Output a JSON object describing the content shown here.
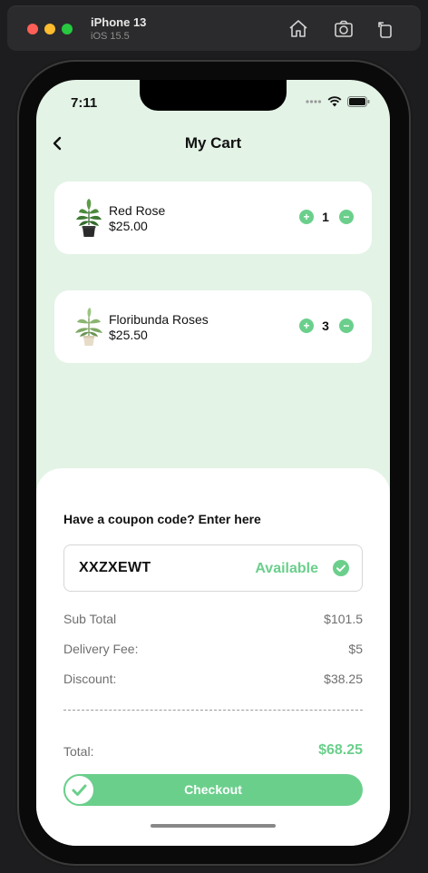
{
  "simulator": {
    "device_name": "iPhone 13",
    "os_version": "iOS 15.5"
  },
  "status_bar": {
    "time": "7:11"
  },
  "header": {
    "title": "My Cart"
  },
  "cart": {
    "items": [
      {
        "name": "Red Rose",
        "price": "$25.00",
        "quantity": "1"
      },
      {
        "name": "Floribunda Roses",
        "price": "$25.50",
        "quantity": "3"
      }
    ]
  },
  "coupon": {
    "heading": "Have a coupon code? Enter here",
    "code": "XXZXEWT",
    "status": "Available"
  },
  "summary": {
    "subtotal_label": "Sub Total",
    "subtotal_value": "$101.5",
    "delivery_label": "Delivery Fee:",
    "delivery_value": "$5",
    "discount_label": "Discount:",
    "discount_value": "$38.25",
    "total_label": "Total:",
    "total_value": "$68.25"
  },
  "checkout": {
    "label": "Checkout"
  },
  "colors": {
    "accent": "#6bcf8c",
    "screen_background": "#e3f3e6"
  }
}
